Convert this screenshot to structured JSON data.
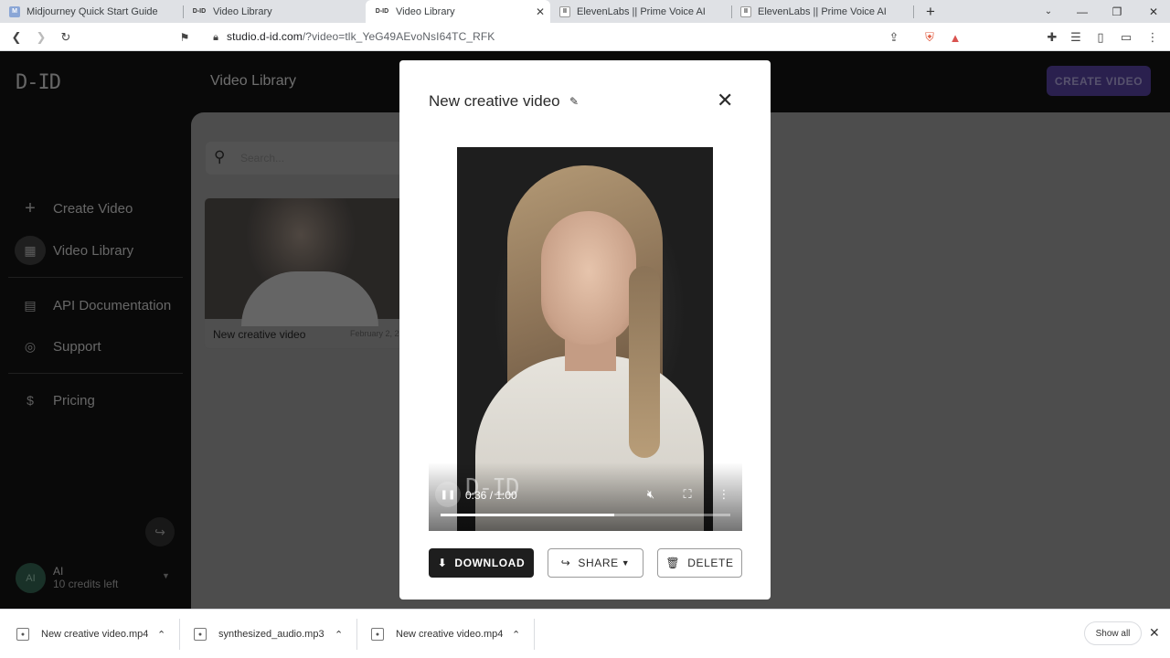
{
  "browser": {
    "tabs": [
      {
        "label": "Midjourney Quick Start Guide",
        "favicon": "M"
      },
      {
        "label": "Video Library",
        "favicon": "D-ID"
      },
      {
        "label": "Video Library",
        "favicon": "D-ID"
      },
      {
        "label": "ElevenLabs || Prime Voice AI",
        "favicon": "II"
      },
      {
        "label": "ElevenLabs || Prime Voice AI",
        "favicon": "II"
      }
    ],
    "new_tab": "+",
    "url_host": "studio.d-id.com",
    "url_path": "/?video=tlk_YeG49AEvoNsI64TC_RFK"
  },
  "app": {
    "logo": "D-ID",
    "page_title": "Video Library",
    "create_button": "CREATE VIDEO",
    "nav": {
      "create_video": "Create Video",
      "video_library": "Video Library",
      "api_docs": "API Documentation",
      "support": "Support",
      "pricing": "Pricing"
    },
    "search_placeholder": "Search...",
    "card": {
      "title": "New creative video",
      "date": "February 2, 2"
    },
    "user": {
      "initials": "AI",
      "name": "AI",
      "credits": "10 credits left"
    }
  },
  "modal": {
    "title": "New creative video",
    "watermark": "D-ID",
    "player": {
      "time": "0:36 / 1:00",
      "progress": 0.6
    },
    "buttons": {
      "download": "DOWNLOAD",
      "share": "SHARE",
      "delete": "DELETE"
    }
  },
  "downloads": {
    "items": [
      "New creative video.mp4",
      "synthesized_audio.mp3",
      "New creative video.mp4"
    ],
    "show_all": "Show all"
  }
}
